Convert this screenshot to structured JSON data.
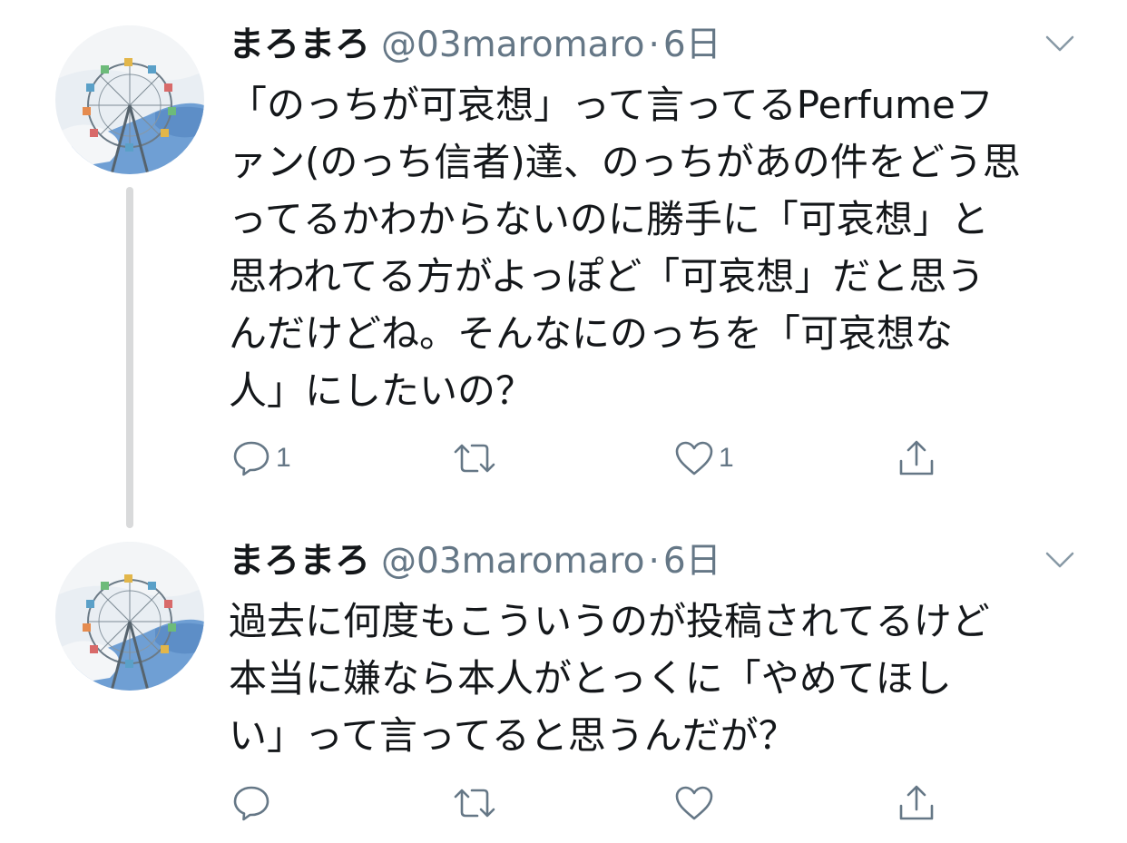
{
  "colors": {
    "text": "#14171a",
    "secondary": "#657786",
    "thread_line": "#d9dadb"
  },
  "tweets": [
    {
      "author": {
        "display_name": "まろまろ",
        "handle": "@03maromaro",
        "avatar_icon": "ferris-wheel-avatar"
      },
      "separator": "·",
      "time": "6日",
      "text_lines": [
        "「のっちが可哀想」って言ってるPerfumeフ",
        "ァン(のっち信者)達、のっちがあの件をどう思",
        "ってるかわからないのに勝手に「可哀想」と",
        "思われてる方がよっぽど「可哀想」だと思う",
        "んだけどね。そんなにのっちを「可哀想な",
        "人」にしたいの？"
      ],
      "actions": {
        "reply_count": "1",
        "retweet_count": "",
        "like_count": "1"
      }
    },
    {
      "author": {
        "display_name": "まろまろ",
        "handle": "@03maromaro",
        "avatar_icon": "ferris-wheel-avatar"
      },
      "separator": "·",
      "time": "6日",
      "text_lines": [
        "過去に何度もこういうのが投稿されてるけど",
        "本当に嫌なら本人がとっくに「やめてほし",
        "い」って言ってると思うんだが？"
      ],
      "actions": {
        "reply_count": "",
        "retweet_count": "",
        "like_count": ""
      }
    }
  ]
}
